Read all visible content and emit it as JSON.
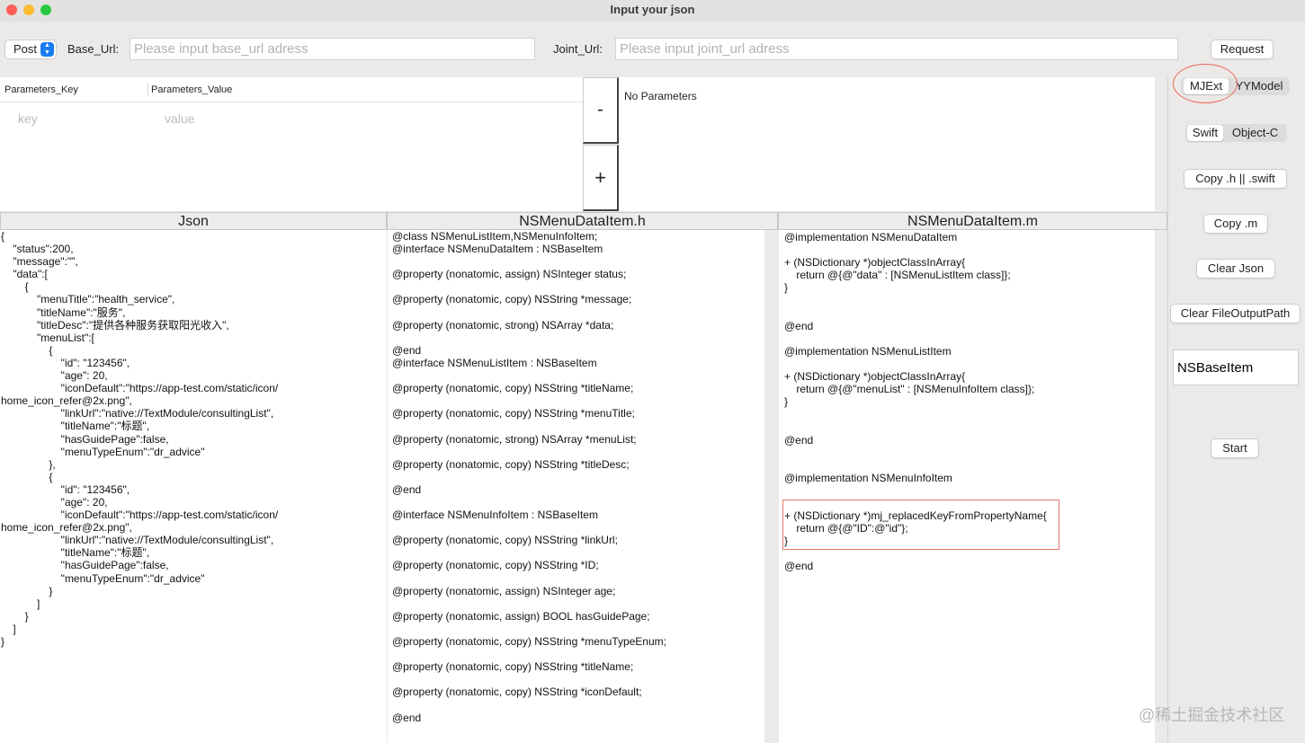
{
  "window": {
    "title": "Input your json",
    "traffic_colors": {
      "close": "#fe5f57",
      "minimize": "#febc2e",
      "zoom": "#28c840"
    }
  },
  "request": {
    "method": "Post",
    "base_url_label": "Base_Url:",
    "base_url_placeholder": "Please input base_url adress",
    "joint_url_label": "Joint_Url:",
    "joint_url_placeholder": "Please input joint_url adress",
    "request_button": "Request"
  },
  "params": {
    "key_header": "Parameters_Key",
    "value_header": "Parameters_Value",
    "key_placeholder": "key",
    "value_placeholder": "value",
    "minus_label": "-",
    "plus_label": "+",
    "status": "No Parameters"
  },
  "columns": {
    "json": "Json",
    "header_file": "NSMenuDataItem.h",
    "impl_file": "NSMenuDataItem.m"
  },
  "json_text": "{\n    \"status\":200,\n    \"message\":\"\",\n    \"data\":[\n        {\n            \"menuTitle\":\"health_service\",\n            \"titleName\":\"服务\",\n            \"titleDesc\":\"提供各种服务获取阳光收入\",\n            \"menuList\":[\n                {\n                    \"id\": \"123456\",\n                    \"age\": 20,\n                    \"iconDefault\":\"https://app-test.com/static/icon/\nhome_icon_refer@2x.png\",\n                    \"linkUrl\":\"native://TextModule/consultingList\",\n                    \"titleName\":\"标题\",\n                    \"hasGuidePage\":false,\n                    \"menuTypeEnum\":\"dr_advice\"\n                },\n                {\n                    \"id\": \"123456\",\n                    \"age\": 20,\n                    \"iconDefault\":\"https://app-test.com/static/icon/\nhome_icon_refer@2x.png\",\n                    \"linkUrl\":\"native://TextModule/consultingList\",\n                    \"titleName\":\"标题\",\n                    \"hasGuidePage\":false,\n                    \"menuTypeEnum\":\"dr_advice\"\n                }\n            ]\n        }\n    ]\n}",
  "h_text": "@class NSMenuListItem,NSMenuInfoItem;\n@interface NSMenuDataItem : NSBaseItem\n\n@property (nonatomic, assign) NSInteger status;\n\n@property (nonatomic, copy) NSString *message;\n\n@property (nonatomic, strong) NSArray *data;\n\n@end\n@interface NSMenuListItem : NSBaseItem\n\n@property (nonatomic, copy) NSString *titleName;\n\n@property (nonatomic, copy) NSString *menuTitle;\n\n@property (nonatomic, strong) NSArray *menuList;\n\n@property (nonatomic, copy) NSString *titleDesc;\n\n@end\n\n@interface NSMenuInfoItem : NSBaseItem\n\n@property (nonatomic, copy) NSString *linkUrl;\n\n@property (nonatomic, copy) NSString *ID;\n\n@property (nonatomic, assign) NSInteger age;\n\n@property (nonatomic, assign) BOOL hasGuidePage;\n\n@property (nonatomic, copy) NSString *menuTypeEnum;\n\n@property (nonatomic, copy) NSString *titleName;\n\n@property (nonatomic, copy) NSString *iconDefault;\n\n@end",
  "m_text": "@implementation NSMenuDataItem\n\n+ (NSDictionary *)objectClassInArray{\n    return @{@\"data\" : [NSMenuListItem class]};\n}\n\n\n@end\n\n@implementation NSMenuListItem\n\n+ (NSDictionary *)objectClassInArray{\n    return @{@\"menuList\" : [NSMenuInfoItem class]};\n}\n\n\n@end\n\n\n@implementation NSMenuInfoItem\n\n\n+ (NSDictionary *)mj_replacedKeyFromPropertyName{\n    return @{@\"ID\":@\"id\"};\n}\n\n@end",
  "side": {
    "framework_options": [
      "MJExt",
      "YYModel"
    ],
    "framework_selected": "MJExt",
    "language_options": [
      "Swift",
      "Object-C"
    ],
    "language_selected": "Swift",
    "copy_h_button": "Copy .h || .swift",
    "copy_m_button": "Copy .m",
    "clear_json_button": "Clear Json",
    "clear_output_button": "Clear FileOutputPath",
    "base_class_value": "NSBaseItem",
    "start_button": "Start"
  },
  "accent": {
    "highlight": "#e2776a",
    "stepper": "#1a7bf2"
  },
  "watermark": "@稀土掘金技术社区"
}
